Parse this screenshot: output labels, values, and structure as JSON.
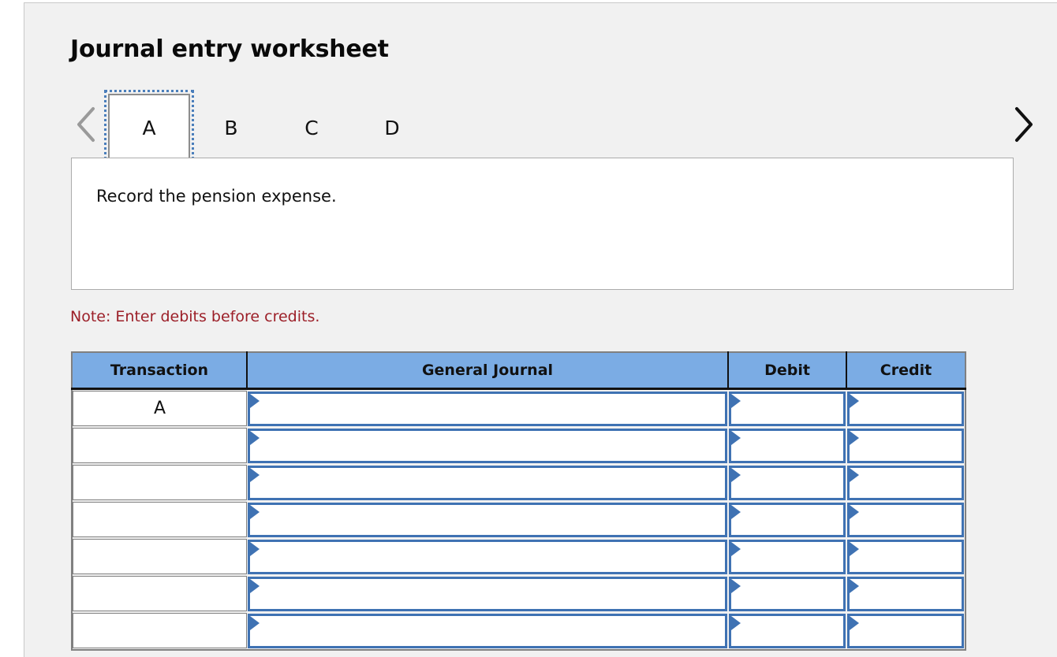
{
  "worksheet": {
    "title": "Journal entry worksheet",
    "prompt": "Record the pension expense.",
    "note": "Note: Enter debits before credits."
  },
  "nav": {
    "prev_icon": "chevron-left-icon",
    "next_icon": "chevron-right-icon",
    "prev_enabled": false,
    "next_enabled": true,
    "prev_color": "#9a9a9a",
    "next_color": "#111111"
  },
  "tabs": [
    {
      "label": "A",
      "active": true
    },
    {
      "label": "B",
      "active": false
    },
    {
      "label": "C",
      "active": false
    },
    {
      "label": "D",
      "active": false
    }
  ],
  "table": {
    "headers": [
      "Transaction",
      "General Journal",
      "Debit",
      "Credit"
    ],
    "rows": [
      {
        "transaction": "A",
        "general_journal": "",
        "debit": "",
        "credit": ""
      },
      {
        "transaction": "",
        "general_journal": "",
        "debit": "",
        "credit": ""
      },
      {
        "transaction": "",
        "general_journal": "",
        "debit": "",
        "credit": ""
      },
      {
        "transaction": "",
        "general_journal": "",
        "debit": "",
        "credit": ""
      },
      {
        "transaction": "",
        "general_journal": "",
        "debit": "",
        "credit": ""
      },
      {
        "transaction": "",
        "general_journal": "",
        "debit": "",
        "credit": ""
      },
      {
        "transaction": "",
        "general_journal": "",
        "debit": "",
        "credit": ""
      }
    ]
  },
  "colors": {
    "header_blue": "#7bace4",
    "field_blue": "#3f72b3",
    "note_red": "#9c1f28",
    "panel_bg": "#f1f1f1"
  }
}
